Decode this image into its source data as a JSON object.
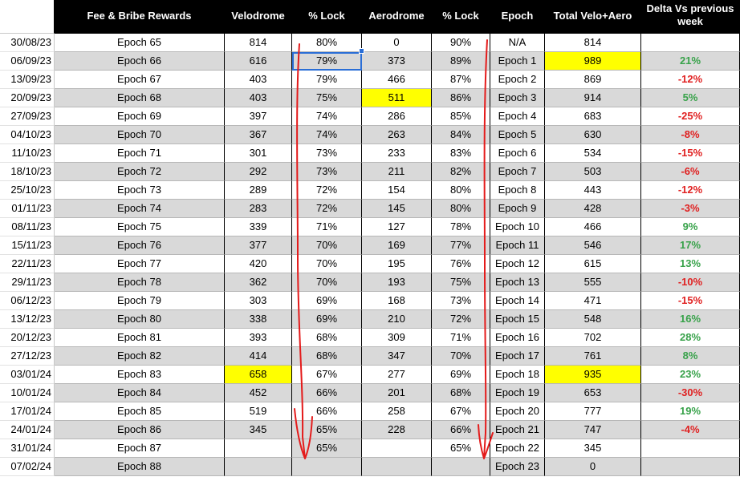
{
  "headers": {
    "date": "",
    "epoch_name": "Fee & Bribe Rewards",
    "velodrome": "Velodrome",
    "velo_lock": "% Lock",
    "aerodrome": "Aerodrome",
    "aero_lock": "% Lock",
    "aero_epoch": "Epoch",
    "total": "Total Velo+Aero",
    "delta": "Delta Vs previous week"
  },
  "rows": [
    {
      "date": "30/08/23",
      "epoch": "Epoch 65",
      "velo": "814",
      "velo_lock": "80%",
      "aero": "0",
      "aero_lock": "90%",
      "aero_epoch": "N/A",
      "total": "814",
      "delta": "",
      "delta_sign": "",
      "velo_hl": false,
      "aero_hl": false,
      "total_hl": false
    },
    {
      "date": "06/09/23",
      "epoch": "Epoch 66",
      "velo": "616",
      "velo_lock": "79%",
      "aero": "373",
      "aero_lock": "89%",
      "aero_epoch": "Epoch 1",
      "total": "989",
      "delta": "21%",
      "delta_sign": "pos",
      "velo_hl": false,
      "aero_hl": false,
      "total_hl": true
    },
    {
      "date": "13/09/23",
      "epoch": "Epoch 67",
      "velo": "403",
      "velo_lock": "79%",
      "aero": "466",
      "aero_lock": "87%",
      "aero_epoch": "Epoch 2",
      "total": "869",
      "delta": "-12%",
      "delta_sign": "neg",
      "velo_hl": false,
      "aero_hl": false,
      "total_hl": false
    },
    {
      "date": "20/09/23",
      "epoch": "Epoch 68",
      "velo": "403",
      "velo_lock": "75%",
      "aero": "511",
      "aero_lock": "86%",
      "aero_epoch": "Epoch 3",
      "total": "914",
      "delta": "5%",
      "delta_sign": "pos",
      "velo_hl": false,
      "aero_hl": true,
      "total_hl": false
    },
    {
      "date": "27/09/23",
      "epoch": "Epoch 69",
      "velo": "397",
      "velo_lock": "74%",
      "aero": "286",
      "aero_lock": "85%",
      "aero_epoch": "Epoch 4",
      "total": "683",
      "delta": "-25%",
      "delta_sign": "neg",
      "velo_hl": false,
      "aero_hl": false,
      "total_hl": false
    },
    {
      "date": "04/10/23",
      "epoch": "Epoch 70",
      "velo": "367",
      "velo_lock": "74%",
      "aero": "263",
      "aero_lock": "84%",
      "aero_epoch": "Epoch 5",
      "total": "630",
      "delta": "-8%",
      "delta_sign": "neg",
      "velo_hl": false,
      "aero_hl": false,
      "total_hl": false
    },
    {
      "date": "11/10/23",
      "epoch": "Epoch 71",
      "velo": "301",
      "velo_lock": "73%",
      "aero": "233",
      "aero_lock": "83%",
      "aero_epoch": "Epoch 6",
      "total": "534",
      "delta": "-15%",
      "delta_sign": "neg",
      "velo_hl": false,
      "aero_hl": false,
      "total_hl": false
    },
    {
      "date": "18/10/23",
      "epoch": "Epoch 72",
      "velo": "292",
      "velo_lock": "73%",
      "aero": "211",
      "aero_lock": "82%",
      "aero_epoch": "Epoch 7",
      "total": "503",
      "delta": "-6%",
      "delta_sign": "neg",
      "velo_hl": false,
      "aero_hl": false,
      "total_hl": false
    },
    {
      "date": "25/10/23",
      "epoch": "Epoch 73",
      "velo": "289",
      "velo_lock": "72%",
      "aero": "154",
      "aero_lock": "80%",
      "aero_epoch": "Epoch 8",
      "total": "443",
      "delta": "-12%",
      "delta_sign": "neg",
      "velo_hl": false,
      "aero_hl": false,
      "total_hl": false
    },
    {
      "date": "01/11/23",
      "epoch": "Epoch 74",
      "velo": "283",
      "velo_lock": "72%",
      "aero": "145",
      "aero_lock": "80%",
      "aero_epoch": "Epoch 9",
      "total": "428",
      "delta": "-3%",
      "delta_sign": "neg",
      "velo_hl": false,
      "aero_hl": false,
      "total_hl": false
    },
    {
      "date": "08/11/23",
      "epoch": "Epoch 75",
      "velo": "339",
      "velo_lock": "71%",
      "aero": "127",
      "aero_lock": "78%",
      "aero_epoch": "Epoch 10",
      "total": "466",
      "delta": "9%",
      "delta_sign": "pos",
      "velo_hl": false,
      "aero_hl": false,
      "total_hl": false
    },
    {
      "date": "15/11/23",
      "epoch": "Epoch 76",
      "velo": "377",
      "velo_lock": "70%",
      "aero": "169",
      "aero_lock": "77%",
      "aero_epoch": "Epoch 11",
      "total": "546",
      "delta": "17%",
      "delta_sign": "pos",
      "velo_hl": false,
      "aero_hl": false,
      "total_hl": false
    },
    {
      "date": "22/11/23",
      "epoch": "Epoch 77",
      "velo": "420",
      "velo_lock": "70%",
      "aero": "195",
      "aero_lock": "76%",
      "aero_epoch": "Epoch 12",
      "total": "615",
      "delta": "13%",
      "delta_sign": "pos",
      "velo_hl": false,
      "aero_hl": false,
      "total_hl": false
    },
    {
      "date": "29/11/23",
      "epoch": "Epoch 78",
      "velo": "362",
      "velo_lock": "70%",
      "aero": "193",
      "aero_lock": "75%",
      "aero_epoch": "Epoch 13",
      "total": "555",
      "delta": "-10%",
      "delta_sign": "neg",
      "velo_hl": false,
      "aero_hl": false,
      "total_hl": false
    },
    {
      "date": "06/12/23",
      "epoch": "Epoch 79",
      "velo": "303",
      "velo_lock": "69%",
      "aero": "168",
      "aero_lock": "73%",
      "aero_epoch": "Epoch 14",
      "total": "471",
      "delta": "-15%",
      "delta_sign": "neg",
      "velo_hl": false,
      "aero_hl": false,
      "total_hl": false
    },
    {
      "date": "13/12/23",
      "epoch": "Epoch 80",
      "velo": "338",
      "velo_lock": "69%",
      "aero": "210",
      "aero_lock": "72%",
      "aero_epoch": "Epoch 15",
      "total": "548",
      "delta": "16%",
      "delta_sign": "pos",
      "velo_hl": false,
      "aero_hl": false,
      "total_hl": false
    },
    {
      "date": "20/12/23",
      "epoch": "Epoch 81",
      "velo": "393",
      "velo_lock": "68%",
      "aero": "309",
      "aero_lock": "71%",
      "aero_epoch": "Epoch 16",
      "total": "702",
      "delta": "28%",
      "delta_sign": "pos",
      "velo_hl": false,
      "aero_hl": false,
      "total_hl": false
    },
    {
      "date": "27/12/23",
      "epoch": "Epoch 82",
      "velo": "414",
      "velo_lock": "68%",
      "aero": "347",
      "aero_lock": "70%",
      "aero_epoch": "Epoch 17",
      "total": "761",
      "delta": "8%",
      "delta_sign": "pos",
      "velo_hl": false,
      "aero_hl": false,
      "total_hl": false
    },
    {
      "date": "03/01/24",
      "epoch": "Epoch 83",
      "velo": "658",
      "velo_lock": "67%",
      "aero": "277",
      "aero_lock": "69%",
      "aero_epoch": "Epoch 18",
      "total": "935",
      "delta": "23%",
      "delta_sign": "pos",
      "velo_hl": true,
      "aero_hl": false,
      "total_hl": true
    },
    {
      "date": "10/01/24",
      "epoch": "Epoch 84",
      "velo": "452",
      "velo_lock": "66%",
      "aero": "201",
      "aero_lock": "68%",
      "aero_epoch": "Epoch 19",
      "total": "653",
      "delta": "-30%",
      "delta_sign": "neg",
      "velo_hl": false,
      "aero_hl": false,
      "total_hl": false
    },
    {
      "date": "17/01/24",
      "epoch": "Epoch 85",
      "velo": "519",
      "velo_lock": "66%",
      "aero": "258",
      "aero_lock": "67%",
      "aero_epoch": "Epoch 20",
      "total": "777",
      "delta": "19%",
      "delta_sign": "pos",
      "velo_hl": false,
      "aero_hl": false,
      "total_hl": false
    },
    {
      "date": "24/01/24",
      "epoch": "Epoch 86",
      "velo": "345",
      "velo_lock": "65%",
      "aero": "228",
      "aero_lock": "66%",
      "aero_epoch": "Epoch 21",
      "total": "747",
      "delta": "-4%",
      "delta_sign": "neg",
      "velo_hl": false,
      "aero_hl": false,
      "total_hl": false
    },
    {
      "date": "31/01/24",
      "epoch": "Epoch 87",
      "velo": "",
      "velo_lock": "65%",
      "aero": "",
      "aero_lock": "65%",
      "aero_epoch": "Epoch 22",
      "total": "345",
      "delta": "",
      "delta_sign": "",
      "velo_hl": false,
      "aero_hl": false,
      "total_hl": false
    },
    {
      "date": "07/02/24",
      "epoch": "Epoch 88",
      "velo": "",
      "velo_lock": "",
      "aero": "",
      "aero_lock": "",
      "aero_epoch": "Epoch 23",
      "total": "0",
      "delta": "",
      "delta_sign": "",
      "velo_hl": false,
      "aero_hl": false,
      "total_hl": false
    }
  ],
  "colors": {
    "header_bg": "#000000",
    "header_text": "#ffffff",
    "stripe_gray": "#d9d9d9",
    "highlight_yellow": "#ffff00",
    "positive_green": "#38a24a",
    "negative_red": "#e02020",
    "annotation_red": "#e41b1b",
    "selection_blue": "#2a6ed6"
  },
  "selection": {
    "row": 1,
    "column": "velo_lock"
  }
}
